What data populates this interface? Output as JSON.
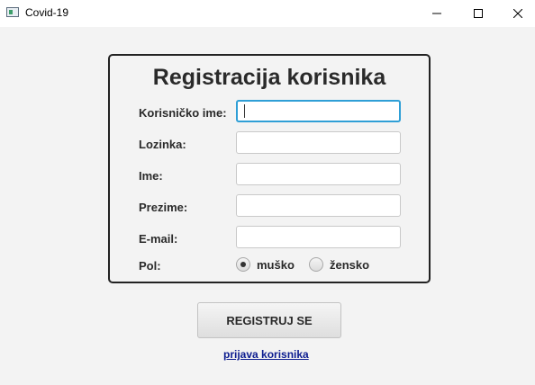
{
  "window": {
    "title": "Covid-19",
    "app_icon": "app-window-icon",
    "controls": [
      "minimize-icon",
      "maximize-icon",
      "close-icon"
    ]
  },
  "form": {
    "heading": "Registracija korisnika",
    "fields": [
      {
        "label": "Korisničko ime:",
        "value": "",
        "focused": true
      },
      {
        "label": "Lozinka:",
        "value": ""
      },
      {
        "label": "Ime:",
        "value": ""
      },
      {
        "label": "Prezime:",
        "value": ""
      },
      {
        "label": "E-mail:",
        "value": ""
      }
    ],
    "gender": {
      "label": "Pol:",
      "options": [
        {
          "label": "muško",
          "selected": true
        },
        {
          "label": "žensko",
          "selected": false
        }
      ]
    },
    "submit_label": "REGISTRUJ SE",
    "login_link": "prijava korisnika"
  },
  "colors": {
    "focus_border": "#2f9fd6",
    "link": "#0b1b8f",
    "background": "#f3f3f3"
  }
}
